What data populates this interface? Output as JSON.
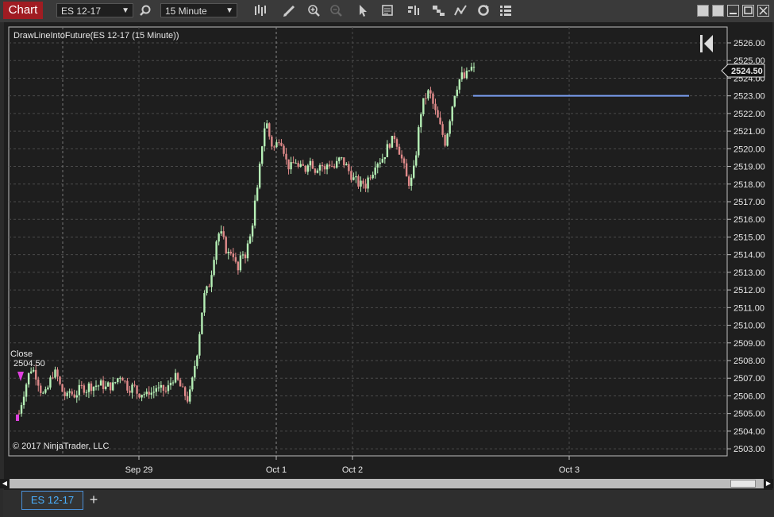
{
  "toolbar": {
    "chart_tab": "Chart",
    "instrument": "ES 12-17",
    "interval": "15 Minute"
  },
  "chart": {
    "indicator_label": "DrawLineIntoFuture(ES 12-17 (15 Minute))",
    "close_label": "Close",
    "close_value": "2504.50",
    "last_price_tag": "2524.50",
    "copyright": "© 2017 NinjaTrader, LLC",
    "price_ticks": [
      "2526.00",
      "2525.00",
      "2524.00",
      "2523.00",
      "2522.00",
      "2521.00",
      "2520.00",
      "2519.00",
      "2518.00",
      "2517.00",
      "2516.00",
      "2515.00",
      "2514.00",
      "2513.00",
      "2512.00",
      "2511.00",
      "2510.00",
      "2509.00",
      "2508.00",
      "2507.00",
      "2506.00",
      "2505.00",
      "2504.00",
      "2503.00"
    ],
    "date_ticks": [
      "Sep 29",
      "Oct 1",
      "Oct 2",
      "Oct 3"
    ],
    "future_line_price": 2523.0,
    "colors": {
      "up": "#b6f0b6",
      "down": "#e08a8a",
      "line": "#7a9ef0",
      "grid": "#4a4a4a"
    }
  },
  "chart_data": {
    "type": "candlestick",
    "y_range": [
      2502.6,
      2526.9
    ],
    "price_path": [
      2505.0,
      2505.8,
      2506.5,
      2507.2,
      2507.6,
      2507.3,
      2506.8,
      2506.2,
      2506.0,
      2506.4,
      2507.0,
      2507.4,
      2507.1,
      2506.5,
      2506.1,
      2505.9,
      2506.3,
      2506.0,
      2506.1,
      2506.4,
      2506.5,
      2506.3,
      2506.6,
      2506.5,
      2506.6,
      2506.6,
      2506.7,
      2506.4,
      2506.6,
      2506.5,
      2506.7,
      2507.0,
      2507.2,
      2506.9,
      2506.5,
      2506.4,
      2506.6,
      2506.2,
      2506.1,
      2506.2,
      2506.0,
      2506.3,
      2506.1,
      2506.5,
      2506.3,
      2506.4,
      2506.2,
      2506.5,
      2506.9,
      2507.1,
      2506.8,
      2506.4,
      2506.1,
      2505.8,
      2506.3,
      2507.5,
      2508.5,
      2510.0,
      2511.6,
      2512.0,
      2512.4,
      2513.6,
      2514.8,
      2515.3,
      2515.0,
      2514.3,
      2514.0,
      2514.3,
      2513.5,
      2513.0,
      2514.2,
      2513.9,
      2514.6,
      2515.2,
      2516.8,
      2517.7,
      2519.6,
      2521.2,
      2521.4,
      2520.4,
      2520.0,
      2520.3,
      2520.7,
      2520.1,
      2519.3,
      2518.9,
      2519.1,
      2519.3,
      2518.8,
      2519.0,
      2518.8,
      2519.4,
      2519.2,
      2518.8,
      2519.0,
      2519.2,
      2518.7,
      2519.2,
      2519.1,
      2518.9,
      2519.2,
      2519.5,
      2519.2,
      2519.0,
      2518.6,
      2518.3,
      2518.2,
      2517.9,
      2518.1,
      2517.9,
      2518.5,
      2518.6,
      2519.2,
      2519.3,
      2519.4,
      2519.7,
      2520.2,
      2520.4,
      2520.7,
      2520.2,
      2519.6,
      2519.0,
      2518.2,
      2518.0,
      2518.7,
      2520.0,
      2521.8,
      2522.6,
      2523.0,
      2523.3,
      2522.6,
      2522.0,
      2521.5,
      2520.9,
      2520.3,
      2521.3,
      2522.3,
      2523.2,
      2523.7,
      2524.2,
      2524.0,
      2524.3,
      2524.6,
      2524.5
    ],
    "dates": [
      "Sep 29",
      "Oct 1",
      "Oct 2",
      "Oct 3"
    ]
  }
}
